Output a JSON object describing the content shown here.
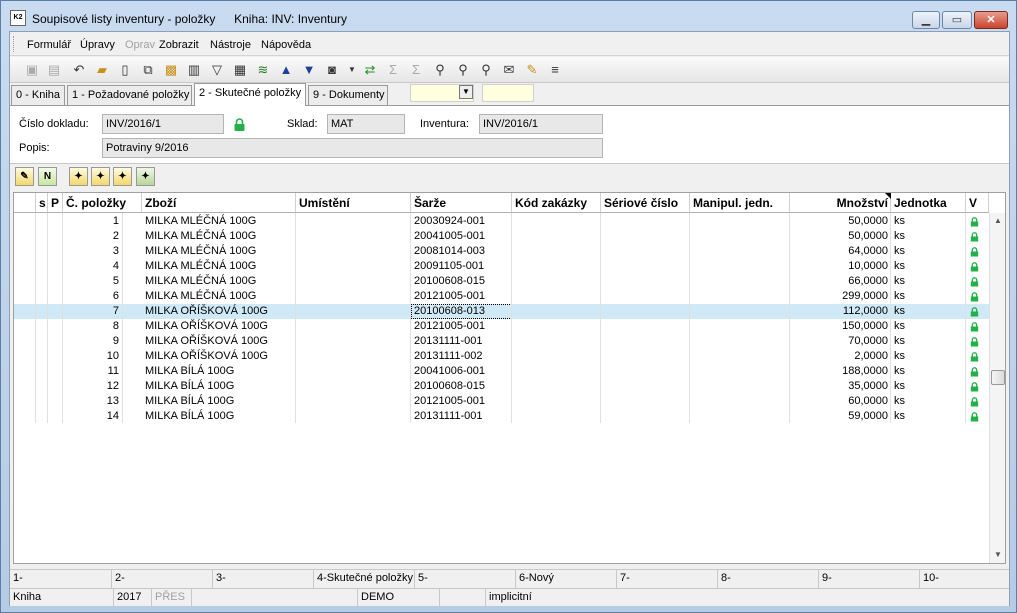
{
  "window": {
    "title": "Soupisové listy inventury - položky",
    "subtitle": "Kniha: INV: Inventury",
    "app_icon": "K2"
  },
  "menu": [
    "Formulář",
    "Úpravy",
    "Oprav",
    "Zobrazit",
    "Nástroje",
    "Nápověda"
  ],
  "tabs": [
    "0 - Kniha",
    "1 - Požadované položky",
    "2 - Skutečné položky",
    "9 - Dokumenty"
  ],
  "header": {
    "cislo_label": "Číslo dokladu:",
    "cislo_value": "INV/2016/1",
    "sklad_label": "Sklad:",
    "sklad_value": "MAT",
    "inventura_label": "Inventura:",
    "inventura_value": "INV/2016/1",
    "popis_label": "Popis:",
    "popis_value": "Potraviny 9/2016"
  },
  "columns": [
    "s",
    "P",
    "Č. položky",
    "Zboží",
    "Umístění",
    "Šarže",
    "Kód zakázky",
    "Sériové číslo",
    "Manipul. jedn.",
    "Množství",
    "Jednotka",
    "V"
  ],
  "rows": [
    {
      "no": "1",
      "item": "MILKA MLÉČNÁ 100G",
      "batch": "20030924-001",
      "qty": "50,0000",
      "unit": "ks"
    },
    {
      "no": "2",
      "item": "MILKA MLÉČNÁ 100G",
      "batch": "20041005-001",
      "qty": "50,0000",
      "unit": "ks"
    },
    {
      "no": "3",
      "item": "MILKA MLÉČNÁ 100G",
      "batch": "20081014-003",
      "qty": "64,0000",
      "unit": "ks"
    },
    {
      "no": "4",
      "item": "MILKA MLÉČNÁ 100G",
      "batch": "20091105-001",
      "qty": "10,0000",
      "unit": "ks"
    },
    {
      "no": "5",
      "item": "MILKA MLÉČNÁ 100G",
      "batch": "20100608-015",
      "qty": "66,0000",
      "unit": "ks"
    },
    {
      "no": "6",
      "item": "MILKA MLÉČNÁ 100G",
      "batch": "20121005-001",
      "qty": "299,0000",
      "unit": "ks"
    },
    {
      "no": "7",
      "item": "MILKA OŘÍŠKOVÁ 100G",
      "batch": "20100608-013",
      "qty": "112,0000",
      "unit": "ks"
    },
    {
      "no": "8",
      "item": "MILKA OŘÍŠKOVÁ 100G",
      "batch": "20121005-001",
      "qty": "150,0000",
      "unit": "ks"
    },
    {
      "no": "9",
      "item": "MILKA OŘÍŠKOVÁ 100G",
      "batch": "20131111-001",
      "qty": "70,0000",
      "unit": "ks"
    },
    {
      "no": "10",
      "item": "MILKA OŘÍŠKOVÁ 100G",
      "batch": "20131111-002",
      "qty": "2,0000",
      "unit": "ks"
    },
    {
      "no": "11",
      "item": "MILKA BÍLÁ 100G",
      "batch": "20041006-001",
      "qty": "188,0000",
      "unit": "ks"
    },
    {
      "no": "12",
      "item": "MILKA BÍLÁ 100G",
      "batch": "20100608-015",
      "qty": "35,0000",
      "unit": "ks"
    },
    {
      "no": "13",
      "item": "MILKA BÍLÁ 100G",
      "batch": "20121005-001",
      "qty": "60,0000",
      "unit": "ks"
    },
    {
      "no": "14",
      "item": "MILKA BÍLÁ 100G",
      "batch": "20131111-001",
      "qty": "59,0000",
      "unit": "ks"
    }
  ],
  "selected_row": "7",
  "fkeys": [
    "1-",
    "2-",
    "3-",
    "4-Skutečné položky",
    "5-",
    "6-Nový",
    "7-",
    "8-",
    "9-",
    "10-"
  ],
  "status": [
    "Kniha",
    "2017",
    "PŘES",
    "",
    "DEMO",
    "",
    "implicitní"
  ],
  "colors": {
    "selected_row": "#cfe9f7",
    "lock": "#22b04a",
    "field_yellow": "#ffffe0"
  }
}
